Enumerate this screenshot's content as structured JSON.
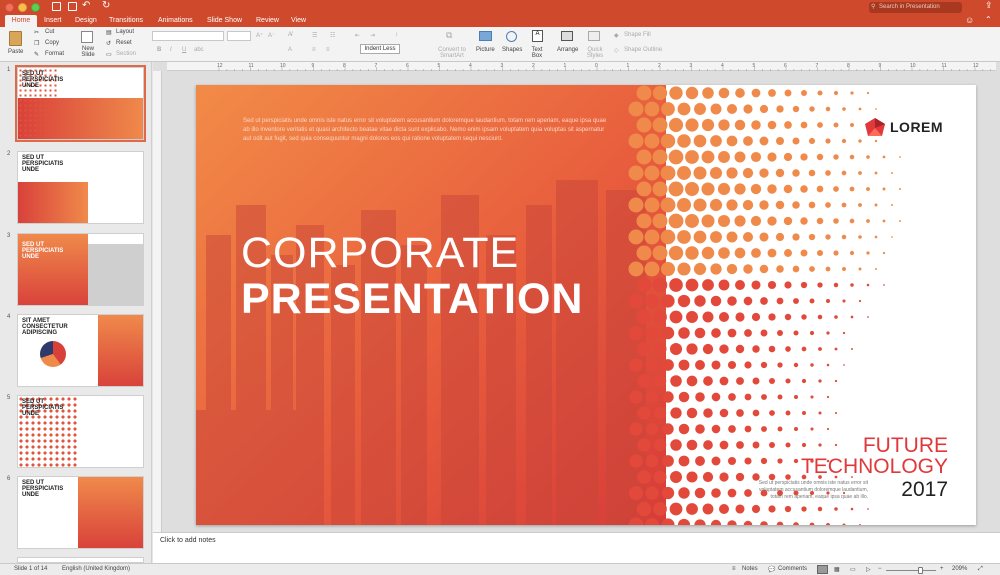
{
  "window": {
    "search_placeholder": "Search in Presentation"
  },
  "tabs": [
    "Home",
    "Insert",
    "Design",
    "Transitions",
    "Animations",
    "Slide Show",
    "Review",
    "View"
  ],
  "ribbon": {
    "paste": "Paste",
    "cut": "Cut",
    "copy": "Copy",
    "format": "Format",
    "new_slide": "New Slide",
    "layout": "Layout",
    "reset": "Reset",
    "section": "Section",
    "tooltip": "Indent Less",
    "convert": "Convert to SmartArt",
    "picture": "Picture",
    "shapes": "Shapes",
    "textbox": "Text Box",
    "arrange": "Arrange",
    "quick_styles": "Quick Styles",
    "shape_fill": "Shape Fill",
    "shape_outline": "Shape Outline"
  },
  "thumbnails": [
    {
      "num": "1",
      "title": "SED UT PERSPICIATIS UNDE"
    },
    {
      "num": "2",
      "title": "SED UT PERSPICIATIS UNDE"
    },
    {
      "num": "3",
      "title": "SED UT PERSPICIATIS UNDE"
    },
    {
      "num": "4",
      "title": "SIT AMET CONSECTETUR ADIPISCING"
    },
    {
      "num": "5",
      "title": "SED UT PERSPICIATIS UNDE"
    },
    {
      "num": "6",
      "title": "SED UT PERSPICIATIS UNDE"
    }
  ],
  "slide": {
    "intro_text": "Sed ut perspiciatis unde omnis iste natus error sit voluptatem accusantium doloremque laudantium, totam rem aperiam, eaque ipsa quae ab illo inventore veritatis et quasi architecto beatae vitae dicta sunt explicabo. Nemo enim ipsam voluptatem quia voluptas sit aspernatur aut odit aut fugit, sed quia consequuntur magni dolores eos qui ratione voluptatem sequi nesciunt.",
    "title_line1": "CORPORATE",
    "title_line2": "PRESENTATION",
    "logo_text": "LOREM",
    "future": "FUTURE",
    "technology": "TECHNOLOGY",
    "small_text": "Sed ut perspiciatis unde omnis iste natus error sit voluptatem accusantium doloremque laudantium, totam rem aperiam, eaque ipsa quae ab illo.",
    "year": "2017"
  },
  "notes": "Click to add notes",
  "status": {
    "slide_of": "Slide 1 of 14",
    "language": "English (United Kingdom)",
    "notes": "Notes",
    "comments": "Comments",
    "zoom": "209%"
  },
  "ruler": [
    "12",
    "11",
    "10",
    "9",
    "8",
    "7",
    "6",
    "5",
    "4",
    "3",
    "2",
    "1",
    "0",
    "1",
    "2",
    "3",
    "4",
    "5",
    "6",
    "7",
    "8",
    "9",
    "10",
    "11",
    "12"
  ],
  "colors": {
    "accent": "#cf4a2c",
    "gradient_start": "#f0884a",
    "gradient_end": "#d8413a",
    "title_red": "#e0393c"
  }
}
